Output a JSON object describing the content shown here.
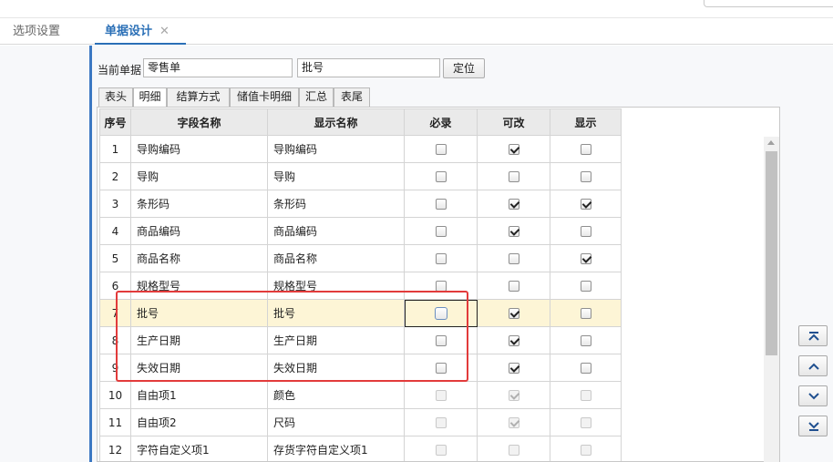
{
  "tabs": {
    "options_label": "选项设置",
    "design_label": "单据设计",
    "design_close": "✕"
  },
  "form": {
    "current_doc_label": "当前单据",
    "current_doc_value": "零售单",
    "search_value": "批号",
    "locate_button": "定位"
  },
  "subtabs": [
    "表头",
    "明细",
    "结算方式",
    "储值卡明细",
    "汇总",
    "表尾"
  ],
  "active_subtab": "明细",
  "grid": {
    "columns": [
      "序号",
      "字段名称",
      "显示名称",
      "必录",
      "可改",
      "显示"
    ],
    "rows": [
      {
        "no": "1",
        "field": "导购编码",
        "display": "导购编码",
        "required": false,
        "editable": true,
        "visible": false,
        "disabled": false
      },
      {
        "no": "2",
        "field": "导购",
        "display": "导购",
        "required": false,
        "editable": false,
        "visible": false,
        "disabled": false
      },
      {
        "no": "3",
        "field": "条形码",
        "display": "条形码",
        "required": false,
        "editable": true,
        "visible": true,
        "disabled": false
      },
      {
        "no": "4",
        "field": "商品编码",
        "display": "商品编码",
        "required": false,
        "editable": true,
        "visible": false,
        "disabled": false
      },
      {
        "no": "5",
        "field": "商品名称",
        "display": "商品名称",
        "required": false,
        "editable": false,
        "visible": true,
        "disabled": false
      },
      {
        "no": "6",
        "field": "规格型号",
        "display": "规格型号",
        "required": false,
        "editable": false,
        "visible": false,
        "disabled": false
      },
      {
        "no": "7",
        "field": "批号",
        "display": "批号",
        "required": false,
        "editable": true,
        "visible": false,
        "disabled": false,
        "selected": true
      },
      {
        "no": "8",
        "field": "生产日期",
        "display": "生产日期",
        "required": false,
        "editable": true,
        "visible": false,
        "disabled": false
      },
      {
        "no": "9",
        "field": "失效日期",
        "display": "失效日期",
        "required": false,
        "editable": true,
        "visible": false,
        "disabled": false
      },
      {
        "no": "10",
        "field": "自由项1",
        "display": "颜色",
        "required": false,
        "editable": true,
        "visible": false,
        "disabled": true
      },
      {
        "no": "11",
        "field": "自由项2",
        "display": "尺码",
        "required": false,
        "editable": true,
        "visible": false,
        "disabled": true
      },
      {
        "no": "12",
        "field": "字符自定义项1",
        "display": "存货字符自定义项1",
        "required": false,
        "editable": false,
        "visible": false,
        "disabled": true
      }
    ]
  },
  "colors": {
    "accent": "#2a6fb6",
    "highlight_box": "#e23b3b",
    "selected_row": "#fdf5d6"
  },
  "side_buttons": [
    "move-top-icon",
    "move-up-icon",
    "move-down-icon",
    "move-bottom-icon"
  ]
}
